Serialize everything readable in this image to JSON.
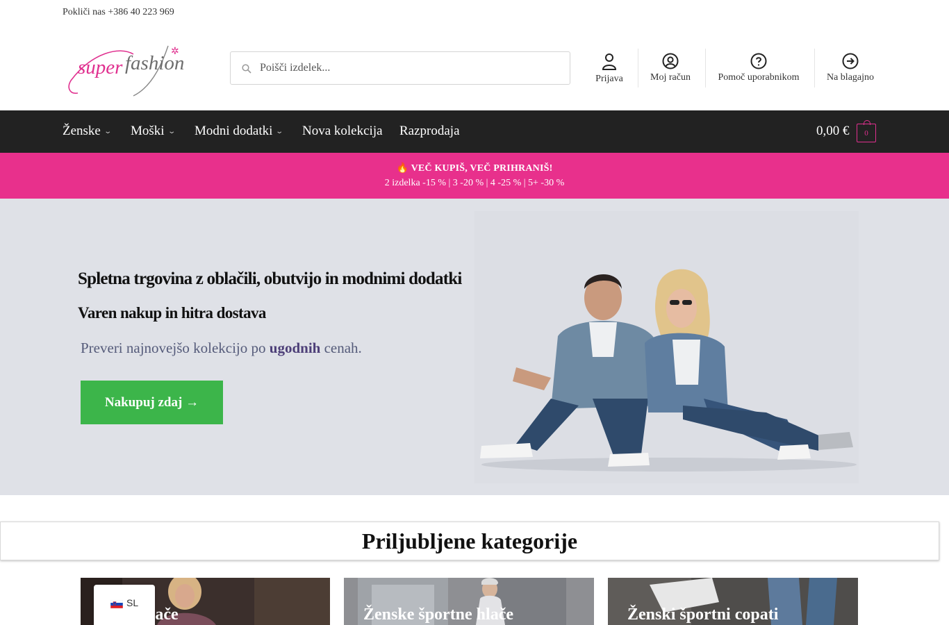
{
  "topbar": {
    "phone_text": "Pokliči nas +386 40 223 969"
  },
  "header": {
    "logo_text_a": "super",
    "logo_text_b": "fashion",
    "search_placeholder": "Poišči izdelek...",
    "links": [
      {
        "label": "Prijava",
        "icon": "user-icon"
      },
      {
        "label": "Moj račun",
        "icon": "account-circle-icon"
      },
      {
        "label": "Pomoč uporabnikom",
        "icon": "help-circle-icon"
      },
      {
        "label": "Na blagajno",
        "icon": "arrow-right-circle-icon"
      }
    ]
  },
  "nav": {
    "items": [
      {
        "label": "Ženske",
        "has_dropdown": true
      },
      {
        "label": "Moški",
        "has_dropdown": true
      },
      {
        "label": "Modni dodatki",
        "has_dropdown": true
      },
      {
        "label": "Nova kolekcija",
        "has_dropdown": false
      },
      {
        "label": "Razprodaja",
        "has_dropdown": false
      }
    ],
    "cart_total": "0,00 €",
    "cart_count": "0"
  },
  "promo": {
    "headline": "🔥 VEČ KUPIŠ, VEČ PRIHRANIŠ!",
    "details": "2 izdelka -15 % | 3 -20 % | 4 -25 % | 5+ -30 %"
  },
  "hero": {
    "title": "Spletna trgovina z oblačili, obutvijo in modnimi dodatki",
    "subtitle": "Varen nakup in hitra dostava",
    "text_before": "Preveri najnovejšo kolekcijo po",
    "text_bold": "ugodnih",
    "text_after": "cenah.",
    "cta_label": "Nakupuj zdaj →"
  },
  "categories": {
    "title": "Priljubljene kategorije",
    "cards": [
      {
        "label": "jeans hlače"
      },
      {
        "label": "Ženske športne hlače"
      },
      {
        "label": "Ženski športni copati"
      }
    ]
  },
  "language": {
    "code": "SL"
  },
  "colors": {
    "accent_pink": "#e8308c",
    "nav_bg": "#222222",
    "cta_green": "#3cb54a",
    "hero_bg": "#dfe1e7"
  }
}
